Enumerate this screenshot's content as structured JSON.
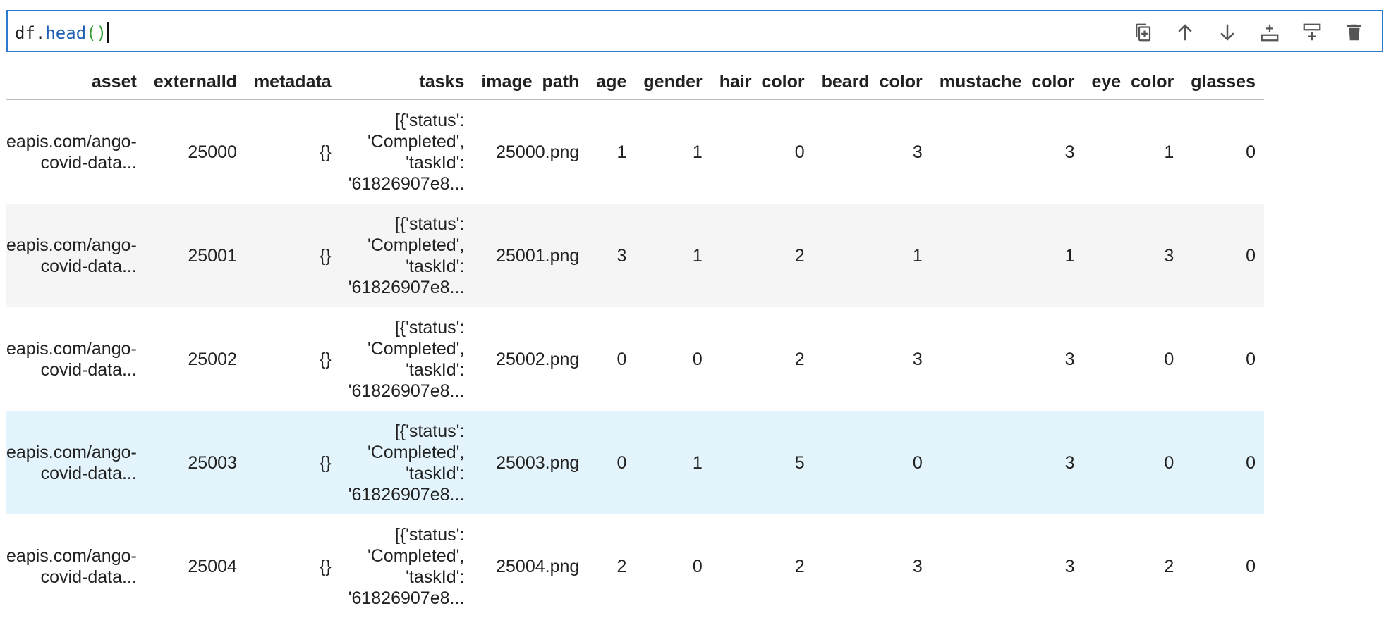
{
  "cell": {
    "code_name": "df",
    "code_dot": ".",
    "code_fn": "head",
    "code_parens": "()"
  },
  "toolbar": {
    "icons": [
      "duplicate-cell-icon",
      "move-up-icon",
      "move-down-icon",
      "insert-below-icon",
      "insert-above-icon",
      "delete-cell-icon"
    ]
  },
  "table": {
    "columns": [
      "asset",
      "externalId",
      "metadata",
      "tasks",
      "image_path",
      "age",
      "gender",
      "hair_color",
      "beard_color",
      "mustache_color",
      "eye_color",
      "glasses"
    ],
    "rows": [
      {
        "asset1": "eapis.com/ango-",
        "asset2": "covid-data...",
        "externalId": "25000",
        "metadata": "{}",
        "t1": "[{'status':",
        "t2": "'Completed',",
        "t3": "'taskId':",
        "t4": "'61826907e8...",
        "image_path": "25000.png",
        "age": "1",
        "gender": "1",
        "hair_color": "0",
        "beard_color": "3",
        "mustache_color": "3",
        "eye_color": "1",
        "glasses": "0"
      },
      {
        "asset1": "eapis.com/ango-",
        "asset2": "covid-data...",
        "externalId": "25001",
        "metadata": "{}",
        "t1": "[{'status':",
        "t2": "'Completed',",
        "t3": "'taskId':",
        "t4": "'61826907e8...",
        "image_path": "25001.png",
        "age": "3",
        "gender": "1",
        "hair_color": "2",
        "beard_color": "1",
        "mustache_color": "1",
        "eye_color": "3",
        "glasses": "0"
      },
      {
        "asset1": "eapis.com/ango-",
        "asset2": "covid-data...",
        "externalId": "25002",
        "metadata": "{}",
        "t1": "[{'status':",
        "t2": "'Completed',",
        "t3": "'taskId':",
        "t4": "'61826907e8...",
        "image_path": "25002.png",
        "age": "0",
        "gender": "0",
        "hair_color": "2",
        "beard_color": "3",
        "mustache_color": "3",
        "eye_color": "0",
        "glasses": "0"
      },
      {
        "asset1": "eapis.com/ango-",
        "asset2": "covid-data...",
        "externalId": "25003",
        "metadata": "{}",
        "t1": "[{'status':",
        "t2": "'Completed',",
        "t3": "'taskId':",
        "t4": "'61826907e8...",
        "image_path": "25003.png",
        "age": "0",
        "gender": "1",
        "hair_color": "5",
        "beard_color": "0",
        "mustache_color": "3",
        "eye_color": "0",
        "glasses": "0"
      },
      {
        "asset1": "eapis.com/ango-",
        "asset2": "covid-data...",
        "externalId": "25004",
        "metadata": "{}",
        "t1": "[{'status':",
        "t2": "'Completed',",
        "t3": "'taskId':",
        "t4": "'61826907e8...",
        "image_path": "25004.png",
        "age": "2",
        "gender": "0",
        "hair_color": "2",
        "beard_color": "3",
        "mustache_color": "3",
        "eye_color": "2",
        "glasses": "0"
      }
    ]
  },
  "colors": {
    "accent": "#2a7bd0",
    "row_alt": "#f5f5f5",
    "row_hover": "#e3f4fc"
  }
}
